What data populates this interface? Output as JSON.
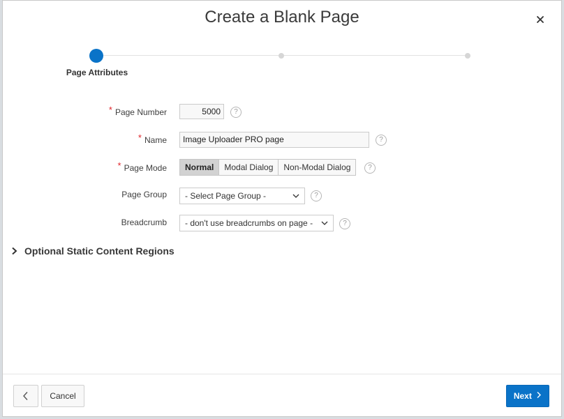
{
  "dialog": {
    "title": "Create a Blank Page",
    "close_icon": "close-icon"
  },
  "wizard": {
    "steps": [
      {
        "label": "Page Attributes",
        "state": "active"
      },
      {
        "label": "",
        "state": "inactive"
      },
      {
        "label": "",
        "state": "inactive"
      }
    ],
    "accent": "#0a73c8"
  },
  "form": {
    "page_number": {
      "label": "Page Number",
      "required": true,
      "value": "5000"
    },
    "name": {
      "label": "Name",
      "required": true,
      "value": "Image Uploader PRO page"
    },
    "page_mode": {
      "label": "Page Mode",
      "required": true,
      "options": [
        "Normal",
        "Modal Dialog",
        "Non-Modal Dialog"
      ],
      "selected": "Normal"
    },
    "page_group": {
      "label": "Page Group",
      "value": "- Select Page Group -"
    },
    "breadcrumb": {
      "label": "Breadcrumb",
      "value": "- don't use breadcrumbs on page -"
    },
    "help_symbol": "?",
    "required_symbol": "*"
  },
  "optional_section": {
    "label": "Optional Static Content Regions",
    "expanded": false
  },
  "footer": {
    "back_icon": "chevron-left-icon",
    "cancel_label": "Cancel",
    "next_label": "Next",
    "next_icon": "chevron-right-icon"
  }
}
